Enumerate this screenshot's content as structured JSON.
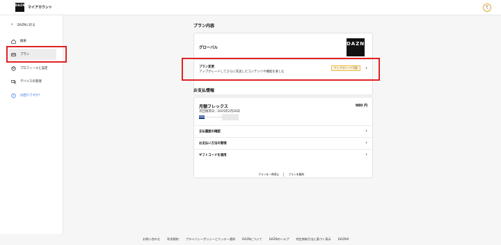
{
  "header": {
    "logo_text": "DAZN",
    "title": "マイアカウント",
    "avatar_initial": "て"
  },
  "sidebar": {
    "back_label": "DAZNに戻る",
    "items": [
      {
        "label": "概要",
        "icon": "home-icon"
      },
      {
        "label": "プラン",
        "icon": "card-icon"
      },
      {
        "label": "プロフィールと設定",
        "icon": "profile-icon"
      },
      {
        "label": "デバイスの管理",
        "icon": "devices-icon"
      },
      {
        "label": "お困りですか？",
        "icon": "help-icon"
      }
    ]
  },
  "plan_section": {
    "title": "プラン内容",
    "plan_name": "グローバル",
    "badge_text": "DAZN",
    "change_title": "プラン変更",
    "change_desc": "アップグレードしてさらに充実したコンテンツや機能を楽しむ",
    "upgrade_badge": "アップグレード可能"
  },
  "payment_section": {
    "title": "お支払情報",
    "plan": "月額フレックス",
    "price": "980 円",
    "next_billing": "次回請求日：2025年2月26日",
    "card_brand": "VISA",
    "card_number": "•••• •••• ••••",
    "links": [
      "支払履歴の確認",
      "お支払い方法の管理",
      "ギフトコードを適用"
    ]
  },
  "footer_actions": [
    "プランを一時停止",
    "プランを解約"
  ],
  "footer": {
    "links": [
      "お問い合わせ",
      "利用規約",
      "プライバシーポリシーとクッキー通知",
      "DAZNについて",
      "DAZNのヘルプ",
      "特定商取引法に基づく表示",
      "DAZN®"
    ]
  },
  "colors": {
    "accent_red": "#e02020",
    "help_blue": "#2f6ee5",
    "upgrade_border": "#e7b94a"
  }
}
